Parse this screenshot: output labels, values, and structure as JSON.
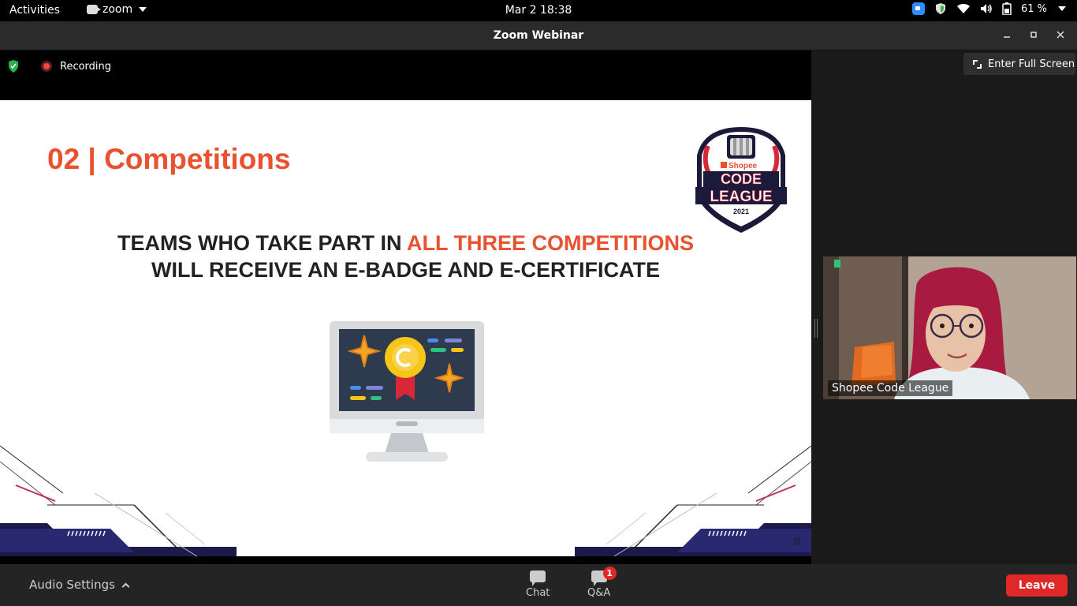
{
  "system_bar": {
    "activities": "Activities",
    "app_name": "zoom",
    "clock": "Mar 2  18:38",
    "battery": "61 %"
  },
  "window": {
    "title": "Zoom Webinar"
  },
  "status": {
    "recording_label": "Recording"
  },
  "slide": {
    "title": "02 | Competitions",
    "line1_prefix": "TEAMS WHO TAKE PART IN ",
    "line1_accent": "ALL THREE COMPETITIONS",
    "line2": "WILL RECEIVE AN E-BADGE AND E-CERTIFICATE",
    "page_number": "8",
    "logo": {
      "brand": "Shopee",
      "line1": "CODE",
      "line2": "LEAGUE",
      "year": "2021"
    }
  },
  "side_panel": {
    "fullscreen_label": "Enter Full Screen",
    "participant_name": "Shopee Code League"
  },
  "toolbar": {
    "audio_settings": "Audio Settings",
    "chat": "Chat",
    "qa": "Q&A",
    "qa_badge": "1",
    "leave": "Leave"
  },
  "colors": {
    "accent": "#e9512f",
    "leave": "#e02828",
    "zoom_blue": "#2d8cff"
  }
}
